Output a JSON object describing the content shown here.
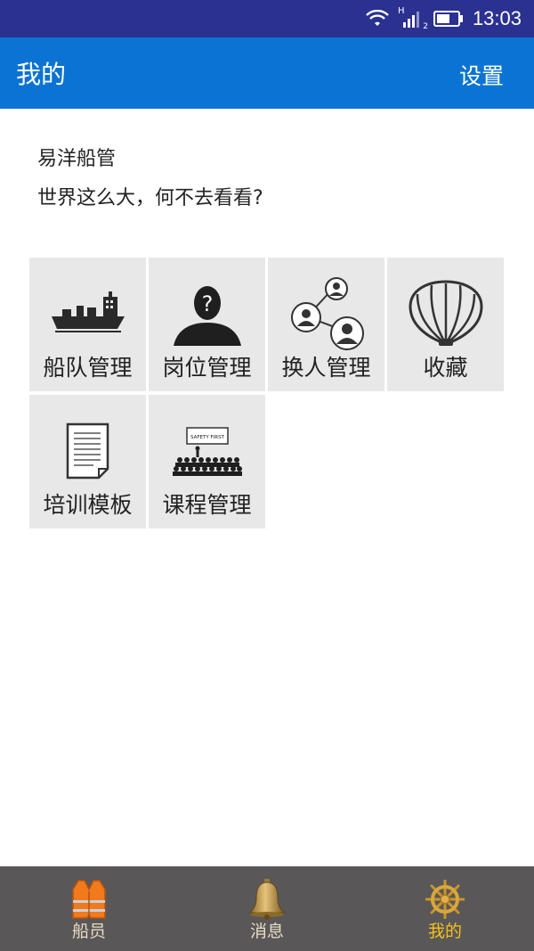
{
  "status_bar": {
    "time": "13:03",
    "network": "H",
    "sim": "2"
  },
  "app_bar": {
    "title": "我的",
    "settings": "设置"
  },
  "profile": {
    "name": "易洋船管",
    "motto": "世界这么大，何不去看看?"
  },
  "tiles": [
    {
      "label": "船队管理",
      "icon": "ship-icon"
    },
    {
      "label": "岗位管理",
      "icon": "person-question-icon"
    },
    {
      "label": "换人管理",
      "icon": "people-network-icon"
    },
    {
      "label": "收藏",
      "icon": "shell-icon"
    },
    {
      "label": "培训模板",
      "icon": "document-icon"
    },
    {
      "label": "课程管理",
      "icon": "classroom-icon",
      "board_text": "SAFETY FIRST"
    }
  ],
  "bottom_nav": [
    {
      "label": "船员",
      "icon": "life-vest-icon",
      "active": false
    },
    {
      "label": "消息",
      "icon": "bell-icon",
      "active": false
    },
    {
      "label": "我的",
      "icon": "ship-wheel-icon",
      "active": true
    }
  ],
  "colors": {
    "status_bar": "#2b3190",
    "app_bar": "#0a73d4",
    "tile_bg": "#e8e8e8",
    "nav_bg": "#5a5758",
    "nav_active": "#f3c21b",
    "nav_inactive": "#e7dcc4"
  }
}
